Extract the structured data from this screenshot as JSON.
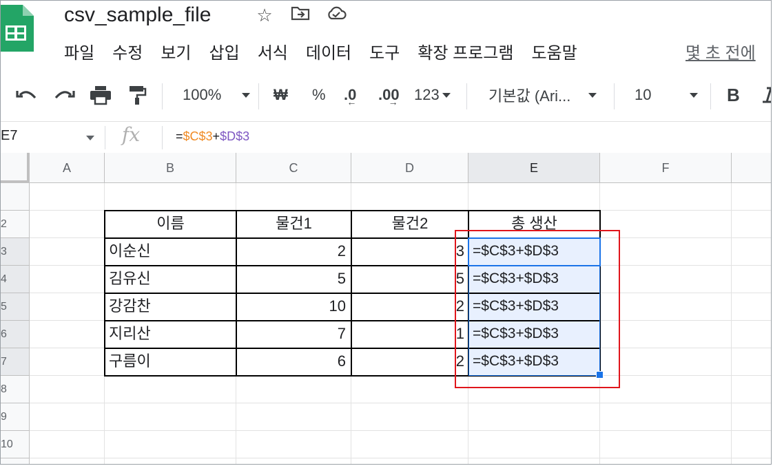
{
  "app": {
    "file_name": "csv_sample_file",
    "last_edit": "몇 초 전에"
  },
  "menu": [
    "파일",
    "수정",
    "보기",
    "삽입",
    "서식",
    "데이터",
    "도구",
    "확장 프로그램",
    "도움말"
  ],
  "toolbar": {
    "zoom": "100%",
    "currency": "₩",
    "percent": "%",
    "dec_decrease": ".0",
    "dec_increase": ".00",
    "format_123": "123",
    "font": "기본값 (Ari...",
    "font_size": "10",
    "bold": "B"
  },
  "formula_bar": {
    "name_box": "E7",
    "fx": "fx",
    "f_eq": "=",
    "f_c": "$C$3",
    "f_plus": "+",
    "f_d": "$D$3"
  },
  "columns": [
    "A",
    "B",
    "C",
    "D",
    "E",
    "F"
  ],
  "row_numbers": [
    "2",
    "3",
    "4",
    "5",
    "6",
    "7",
    "8",
    "9",
    "10"
  ],
  "table": {
    "headers": [
      "이름",
      "물건1",
      "물건2",
      "총 생산"
    ],
    "rows": [
      {
        "name": "이순신",
        "item1": "2",
        "item2": "3",
        "total": "=$C$3+$D$3"
      },
      {
        "name": "김유신",
        "item1": "5",
        "item2": "5",
        "total": "=$C$3+$D$3"
      },
      {
        "name": "강감찬",
        "item1": "10",
        "item2": "2",
        "total": "=$C$3+$D$3"
      },
      {
        "name": "지리산",
        "item1": "7",
        "item2": "1",
        "total": "=$C$3+$D$3"
      },
      {
        "name": "구름이",
        "item1": "6",
        "item2": "2",
        "total": "=$C$3+$D$3"
      }
    ]
  },
  "colors": {
    "selection": "#1a73e8",
    "highlight_box": "#e0151b",
    "formula_ref_c": "#f08a24",
    "formula_ref_d": "#7e57c2"
  }
}
